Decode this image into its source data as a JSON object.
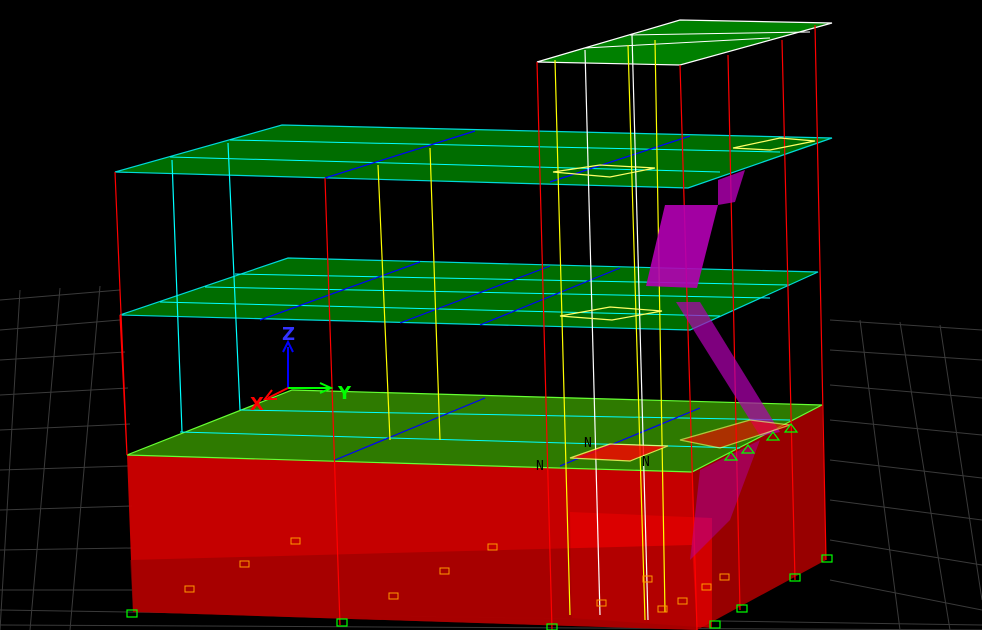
{
  "viewport": {
    "background": "#000000",
    "grid_color": "#3a3a3a",
    "slab_color": "#008000",
    "slab_edge_color": "#00ffff",
    "wall_color": "#e00000",
    "column_color": "#ff0000",
    "beam_color": "#0000ff",
    "stair_color": "#b400b4",
    "opening_color": "#ffff66",
    "support_color": "#00ff00",
    "footing_color": "#ff9900"
  },
  "axes": {
    "x_label": "X",
    "y_label": "Y",
    "z_label": "Z",
    "x_color": "#ff0000",
    "y_color": "#00ff00",
    "z_color": "#0000ff"
  },
  "node_labels": {
    "label_a": "N",
    "label_b": "N",
    "label_c": "N"
  }
}
